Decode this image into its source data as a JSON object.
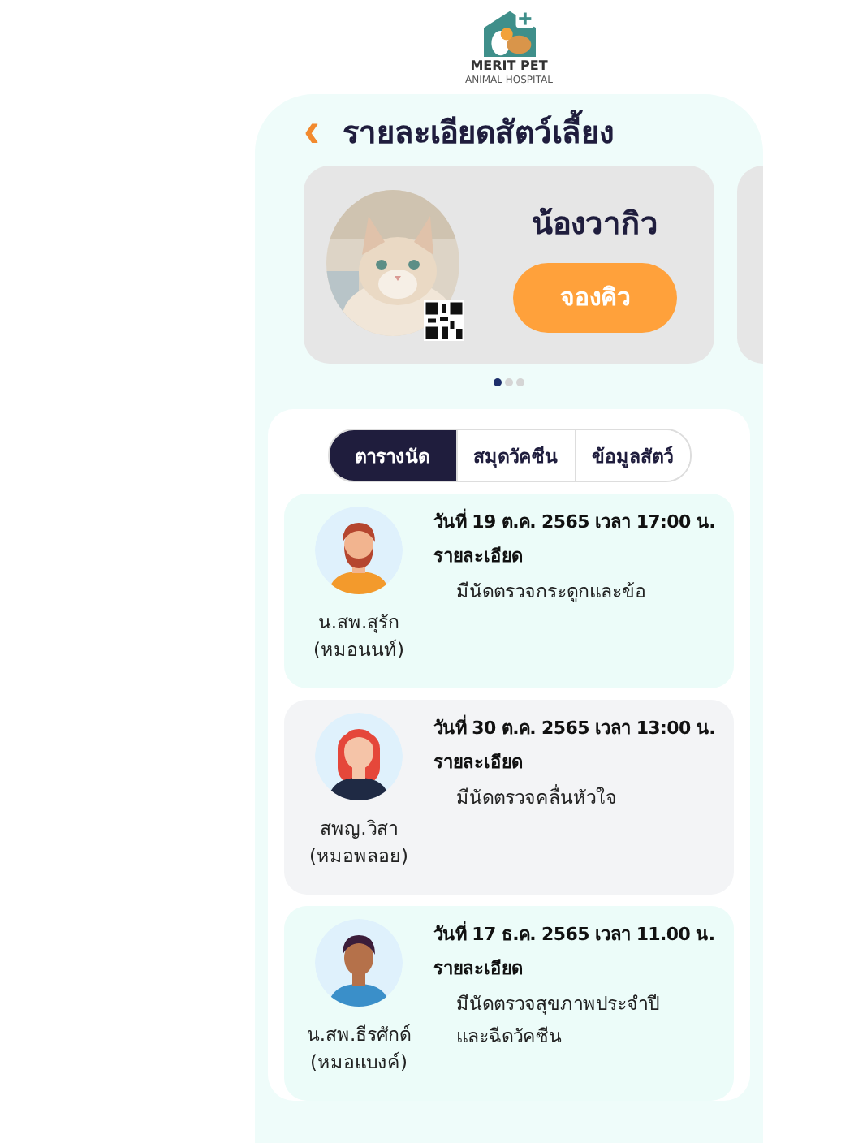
{
  "logo": {
    "name": "MERIT PET",
    "subtitle": "ANIMAL HOSPITAL"
  },
  "header": {
    "back": "‹",
    "title": "รายละเอียดสัตว์เลี้ยง"
  },
  "pet": {
    "name": "น้องวากิว",
    "button": "จองคิว"
  },
  "carousel_dots": [
    {
      "selected": true
    },
    {
      "selected": false
    },
    {
      "selected": false
    }
  ],
  "tabs": [
    {
      "label": "ตารางนัด",
      "selected": true
    },
    {
      "label": "สมุดวัคซีน",
      "selected": false
    },
    {
      "label": "ข้อมูลสัตว์",
      "selected": false
    }
  ],
  "appointments": [
    {
      "color": "#ecfcf9",
      "kind": "man-beard",
      "doctor": "น.สพ.สุรัก",
      "nickname": "(หมอนนท์)",
      "date": "วันที่ 19 ต.ค. 2565 เวลา 17:00 น.",
      "details_label": "รายละเอียด",
      "details": [
        "มีนัดตรวจกระดูกและข้อ"
      ]
    },
    {
      "color": "#f3f4f6",
      "kind": "woman-red",
      "doctor": "สพญ.วิสา",
      "nickname": "(หมอพลอย)",
      "date": "วันที่ 30 ต.ค. 2565 เวลา 13:00 น.",
      "details_label": "รายละเอียด",
      "details": [
        "มีนัดตรวจคลื่นหัวใจ"
      ]
    },
    {
      "color": "#ecfcf9",
      "kind": "man-dark",
      "doctor": "น.สพ.ธีรศักด์",
      "nickname": "(หมอแบงค์)",
      "date": "วันที่ 17 ธ.ค. 2565 เวลา 11.00 น.",
      "details_label": "รายละเอียด",
      "details": [
        "มีนัดตรวจสุขภาพประจำปี",
        "และฉีดวัคซีน"
      ]
    }
  ]
}
